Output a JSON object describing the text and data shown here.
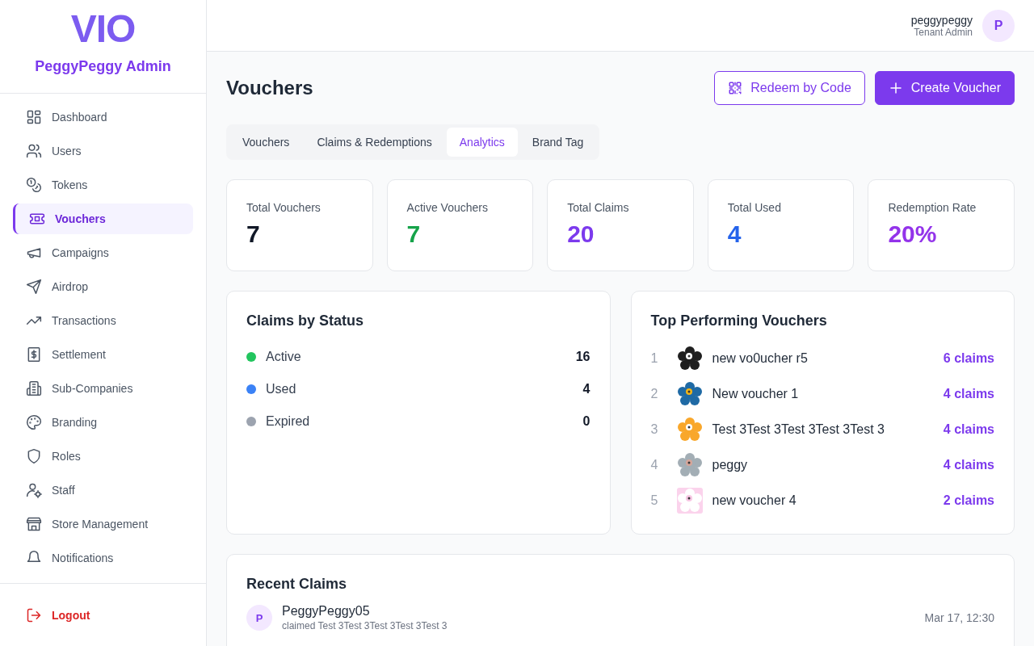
{
  "sidebar": {
    "logo": "VIO",
    "brand": "PeggyPeggy Admin",
    "items": [
      {
        "label": "Dashboard",
        "selected": false
      },
      {
        "label": "Users",
        "selected": false
      },
      {
        "label": "Tokens",
        "selected": false
      },
      {
        "label": "Vouchers",
        "selected": true
      },
      {
        "label": "Campaigns",
        "selected": false
      },
      {
        "label": "Airdrop",
        "selected": false
      },
      {
        "label": "Transactions",
        "selected": false
      },
      {
        "label": "Settlement",
        "selected": false
      },
      {
        "label": "Sub-Companies",
        "selected": false
      },
      {
        "label": "Branding",
        "selected": false
      },
      {
        "label": "Roles",
        "selected": false
      },
      {
        "label": "Staff",
        "selected": false
      },
      {
        "label": "Store Management",
        "selected": false
      },
      {
        "label": "Notifications",
        "selected": false
      }
    ],
    "logout": "Logout"
  },
  "header": {
    "user_name": "peggypeggy",
    "user_role": "Tenant Admin",
    "avatar": "P"
  },
  "page": {
    "title": "Vouchers",
    "buttons": [
      {
        "label": "Redeem by Code",
        "kind": "outline"
      },
      {
        "label": "Create Voucher",
        "kind": "primary"
      }
    ]
  },
  "tabs": [
    {
      "label": "Vouchers",
      "selected": false
    },
    {
      "label": "Claims & Redemptions",
      "selected": false
    },
    {
      "label": "Analytics",
      "selected": true
    },
    {
      "label": "Brand Tag",
      "selected": false
    }
  ],
  "stats": [
    {
      "label": "Total Vouchers",
      "value": "7",
      "color": "#111827"
    },
    {
      "label": "Active Vouchers",
      "value": "7",
      "color": "#16a34a"
    },
    {
      "label": "Total Claims",
      "value": "20",
      "color": "#7c3aed"
    },
    {
      "label": "Total Used",
      "value": "4",
      "color": "#2563eb"
    },
    {
      "label": "Redemption Rate",
      "value": "20%",
      "color": "#9333ea"
    }
  ],
  "claims_by_status": {
    "title": "Claims by Status",
    "rows": [
      {
        "label": "Active",
        "count": "16",
        "color": "#22c55e"
      },
      {
        "label": "Used",
        "count": "4",
        "color": "#3b82f6"
      },
      {
        "label": "Expired",
        "count": "0",
        "color": "#9ca3af"
      }
    ]
  },
  "top_vouchers": {
    "title": "Top Performing Vouchers",
    "rows": [
      {
        "rank": "1",
        "name": "new vo0ucher r5",
        "claims": "6 claims",
        "kind": "picture"
      },
      {
        "rank": "2",
        "name": "New voucher 1",
        "claims": "4 claims",
        "kind": "picture"
      },
      {
        "rank": "3",
        "name": "Test 3Test 3Test 3Test 3Test 3",
        "claims": "4 claims",
        "kind": "picture"
      },
      {
        "rank": "4",
        "name": "peggy",
        "claims": "4 claims",
        "kind": "picture"
      },
      {
        "rank": "5",
        "name": "new voucher 4",
        "claims": "2 claims",
        "kind": "picture"
      }
    ]
  },
  "recent_claims": {
    "title": "Recent Claims",
    "rows": [
      {
        "avatar": "P",
        "name": "PeggyPeggy05",
        "detail": "claimed Test 3Test 3Test 3Test 3Test 3",
        "time": "Mar 17, 12:30"
      }
    ]
  }
}
